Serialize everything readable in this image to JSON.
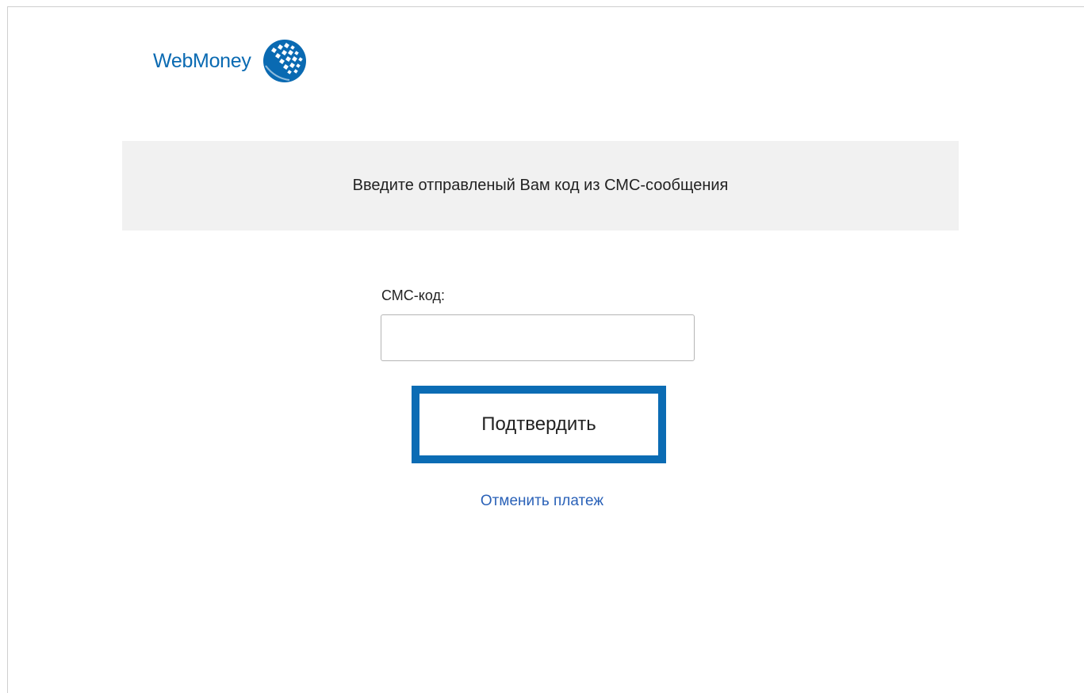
{
  "logo": {
    "text": "WebMoney",
    "icon": "webmoney-globe-icon",
    "brand_color": "#0a6ab2"
  },
  "banner": {
    "text": "Введите отправленый Вам код из СМС-сообщения",
    "background": "#f1f1f1"
  },
  "form": {
    "sms_label": "СМС-код:",
    "sms_value": "",
    "sms_placeholder": "",
    "confirm_label": "Подтвердить",
    "confirm_border_color": "#0b6cb4",
    "cancel_label": "Отменить платеж",
    "link_color": "#2b62b8"
  }
}
